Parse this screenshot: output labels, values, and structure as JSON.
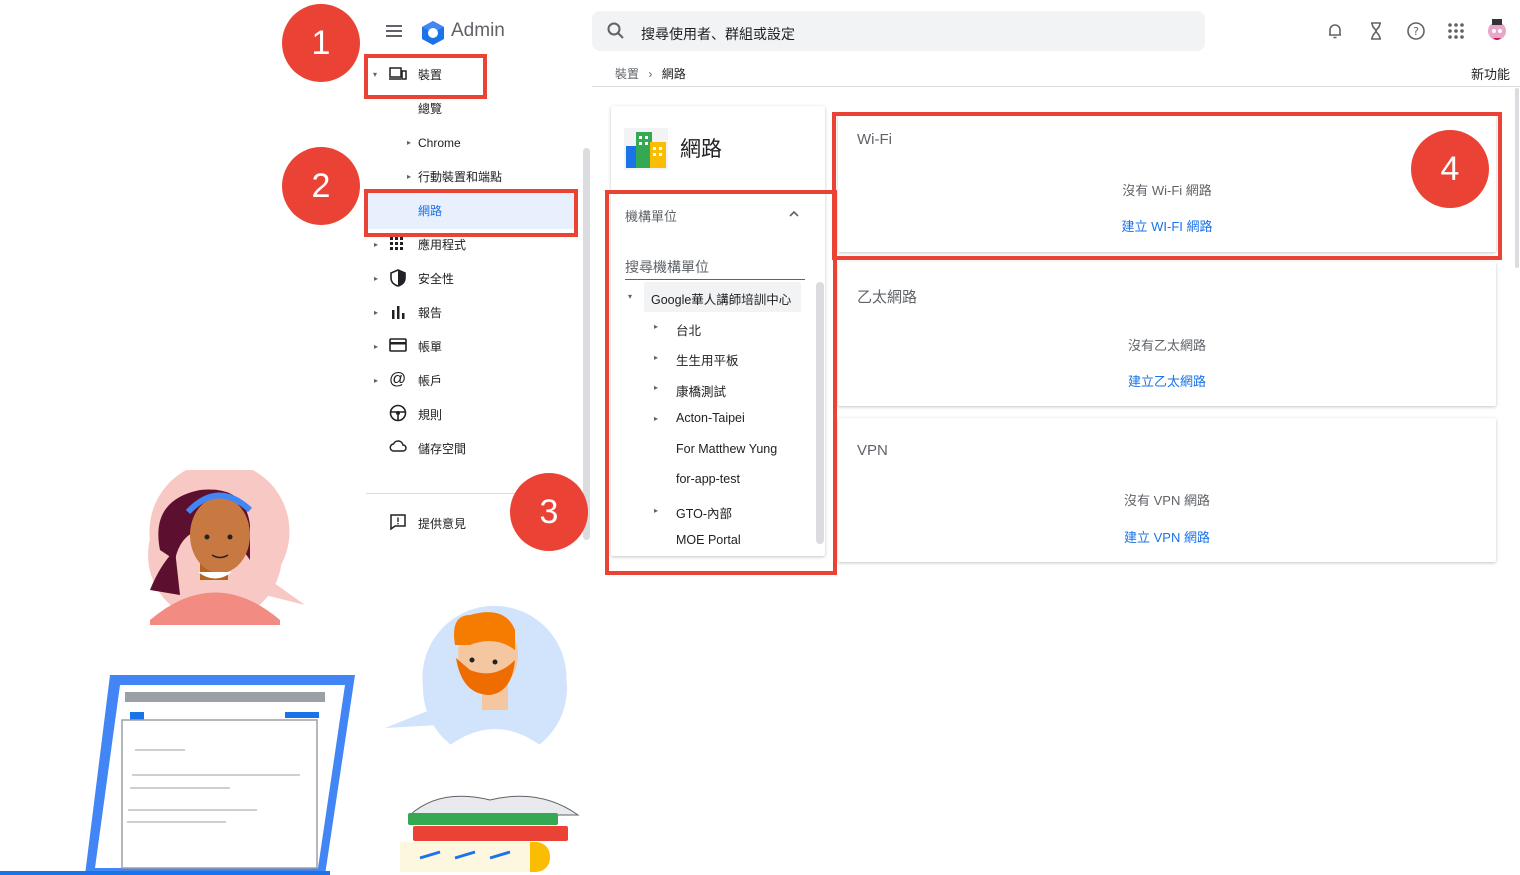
{
  "app": {
    "title": "Admin"
  },
  "search": {
    "placeholder": "搜尋使用者、群組或設定"
  },
  "breadcrumb": {
    "parent": "裝置",
    "separator": "›",
    "current": "網路"
  },
  "header": {
    "whats_new": "新功能"
  },
  "top_icons": [
    "bell-icon",
    "hourglass-icon",
    "help-icon",
    "apps-grid-icon",
    "avatar"
  ],
  "sidebar": {
    "items": [
      {
        "label": "裝置",
        "icon": "devices-icon",
        "arrow": "▾"
      },
      {
        "label": "總覽"
      },
      {
        "label": "Chrome",
        "arrow": "▸"
      },
      {
        "label": "行動裝置和端點",
        "arrow": "▸"
      },
      {
        "label": "網路",
        "active": true
      },
      {
        "label": "應用程式",
        "icon": "apps-icon",
        "arrow": "▸"
      },
      {
        "label": "安全性",
        "icon": "shield-icon",
        "arrow": "▸"
      },
      {
        "label": "報告",
        "icon": "bar-chart-icon",
        "arrow": "▸"
      },
      {
        "label": "帳單",
        "icon": "credit-card-icon",
        "arrow": "▸"
      },
      {
        "label": "帳戶",
        "icon": "at-sign-icon",
        "arrow": "▸"
      },
      {
        "label": "規則",
        "icon": "steering-icon"
      },
      {
        "label": "儲存空間",
        "icon": "cloud-icon"
      }
    ],
    "feedback": "提供意見"
  },
  "ou_panel": {
    "title": "網路",
    "label": "機構單位",
    "search_placeholder": "搜尋機構單位",
    "root": "Google華人講師培訓中心",
    "children": [
      {
        "name": "台北",
        "expandable": true
      },
      {
        "name": "生生用平板",
        "expandable": true
      },
      {
        "name": "康橋測試",
        "expandable": true
      },
      {
        "name": "Acton-Taipei",
        "expandable": true
      },
      {
        "name": "For Matthew Yung",
        "expandable": false
      },
      {
        "name": "for-app-test",
        "expandable": false
      },
      {
        "name": "GTO-內部",
        "expandable": true
      },
      {
        "name": "MOE Portal",
        "expandable": false
      }
    ]
  },
  "network_cards": [
    {
      "title": "Wi-Fi",
      "empty": "沒有 Wi-Fi 網路",
      "action": "建立 WI-FI 網路"
    },
    {
      "title": "乙太網路",
      "empty": "沒有乙太網路",
      "action": "建立乙太網路"
    },
    {
      "title": "VPN",
      "empty": "沒有 VPN 網路",
      "action": "建立 VPN 網路"
    }
  ],
  "annotations": [
    "1",
    "2",
    "3",
    "4"
  ],
  "colors": {
    "accent": "#1a73e8",
    "annotation_red": "#ea4335",
    "active_bg": "#e8f0fe"
  }
}
